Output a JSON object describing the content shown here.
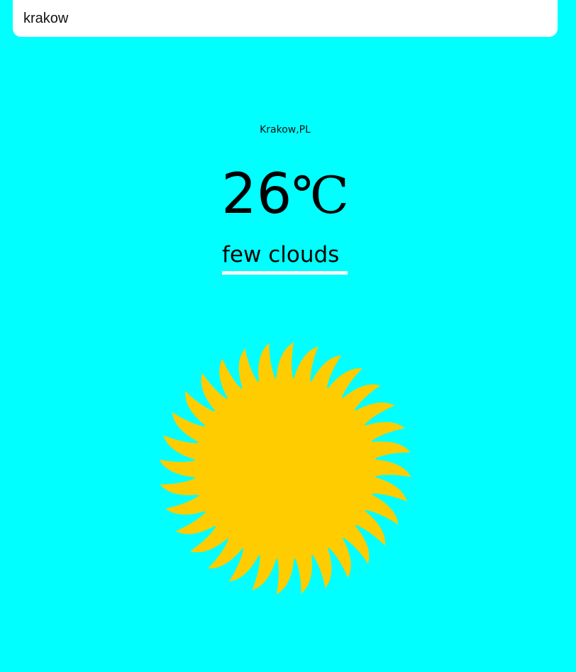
{
  "colors": {
    "background": "#00FFFF",
    "sun": "#FFCC00",
    "underline": "#FFFFFF",
    "text": "#000000"
  },
  "search": {
    "value": "krakow",
    "placeholder": ""
  },
  "weather": {
    "location": "Krakow,PL",
    "temperature": "26",
    "unit": "℃",
    "description": "few clouds",
    "icon": "sun-icon"
  }
}
